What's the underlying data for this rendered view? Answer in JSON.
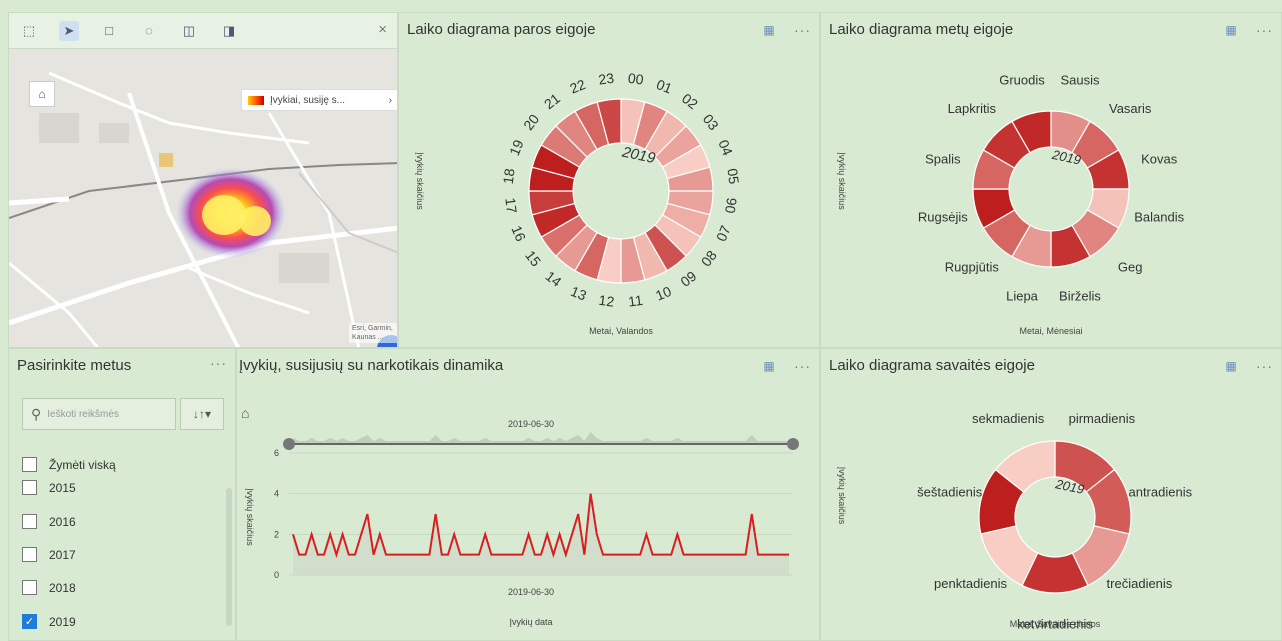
{
  "map": {
    "tools": [
      "select-icon",
      "pointer-icon",
      "rectangle-icon",
      "lasso-icon",
      "circle-icon",
      "panel-icon"
    ],
    "close": "×",
    "home": "⌂",
    "legend_label": "Įvykiai, susiję s...",
    "legend_arrow": "›",
    "attribution": "Esri, Garmin, Kaunas ..."
  },
  "hourly": {
    "title": "Laiko diagrama paros eigoje",
    "ylabel": "Įvykių skaičius",
    "xlabel": "Metai, Valandos",
    "year": "2019"
  },
  "monthly": {
    "title": "Laiko diagrama metų eigoje",
    "ylabel": "Įvykių skaičius",
    "xlabel": "Metai, Mėnesiai",
    "year": "2019"
  },
  "filter": {
    "title": "Pasirinkite metus",
    "search_placeholder": "Ieškoti reikšmės",
    "sort_icon": "↓↑▾",
    "select_all": "Žymėti viską",
    "years": [
      {
        "label": "2015",
        "checked": false
      },
      {
        "label": "2016",
        "checked": false
      },
      {
        "label": "2017",
        "checked": false
      },
      {
        "label": "2018",
        "checked": false
      },
      {
        "label": "2019",
        "checked": true
      }
    ]
  },
  "dynamics": {
    "title": "Įvykių, susijusių su narkotikais dinamika",
    "ylabel": "Įvykių skaičius",
    "xlabel": "Įvykių data",
    "slider_date": "2019-06-30",
    "axis_date": "2019-06-30"
  },
  "weekly": {
    "title": "Laiko diagrama savaitės eigoje",
    "ylabel": "Įvykių skaičius",
    "xlabel": "Metai, Savaitės dienos",
    "year": "2019"
  },
  "menu_dots": "···",
  "chart_data": [
    {
      "type": "pie",
      "categories": [
        "00",
        "01",
        "02",
        "03",
        "04",
        "05",
        "06",
        "07",
        "08",
        "09",
        "10",
        "11",
        "12",
        "13",
        "14",
        "15",
        "16",
        "17",
        "18",
        "19",
        "20",
        "21",
        "22",
        "23"
      ],
      "values": [
        1,
        1,
        1,
        1,
        1,
        1,
        1,
        1,
        1,
        1,
        1,
        1,
        1,
        1,
        1,
        1,
        1,
        1,
        1,
        1,
        1,
        1,
        1,
        1
      ],
      "intensity": [
        0.15,
        0.45,
        0.2,
        0.3,
        0.1,
        0.35,
        0.3,
        0.25,
        0.15,
        0.7,
        0.2,
        0.35,
        0.1,
        0.6,
        0.35,
        0.55,
        0.9,
        0.8,
        0.95,
        0.95,
        0.5,
        0.45,
        0.6,
        0.75
      ],
      "year": "2019"
    },
    {
      "type": "pie",
      "categories": [
        "Sausis",
        "Vasaris",
        "Kovas",
        "Balandis",
        "Geg",
        "Birželis",
        "Liepa",
        "Rugpjūtis",
        "Rugsėjis",
        "Spalis",
        "Lapkritis",
        "Gruodis"
      ],
      "values": [
        1,
        1,
        1,
        1,
        1,
        1,
        1,
        1,
        1,
        1,
        1,
        1
      ],
      "intensity": [
        0.4,
        0.6,
        0.85,
        0.15,
        0.45,
        0.85,
        0.35,
        0.6,
        0.95,
        0.6,
        0.85,
        0.9
      ],
      "year": "2019"
    },
    {
      "type": "line",
      "ylim": [
        0,
        6
      ],
      "yticks": [
        0,
        2,
        4,
        6
      ],
      "values": [
        2,
        1,
        1,
        2,
        1,
        1,
        2,
        1,
        2,
        1,
        1,
        2,
        3,
        1,
        2,
        1,
        1,
        1,
        1,
        1,
        1,
        1,
        1,
        3,
        1,
        1,
        2,
        1,
        1,
        1,
        1,
        2,
        1,
        1,
        1,
        1,
        1,
        1,
        2,
        1,
        1,
        2,
        1,
        2,
        1,
        2,
        3,
        1,
        4,
        2,
        1,
        1,
        1,
        1,
        1,
        1,
        1,
        2,
        1,
        1,
        1,
        1,
        2,
        1,
        1,
        1,
        1,
        1,
        1,
        1,
        1,
        1,
        1,
        1,
        3,
        1,
        1,
        1,
        1,
        1,
        1
      ]
    },
    {
      "type": "pie",
      "categories": [
        "pirmadienis",
        "antradienis",
        "trečiadienis",
        "ketvirtadienis",
        "penktadienis",
        "šeštadienis",
        "sekmadienis"
      ],
      "values": [
        1,
        1,
        1,
        1,
        1,
        1,
        1
      ],
      "intensity": [
        0.7,
        0.65,
        0.35,
        0.85,
        0.1,
        0.95,
        0.1
      ],
      "year": "2019"
    }
  ]
}
